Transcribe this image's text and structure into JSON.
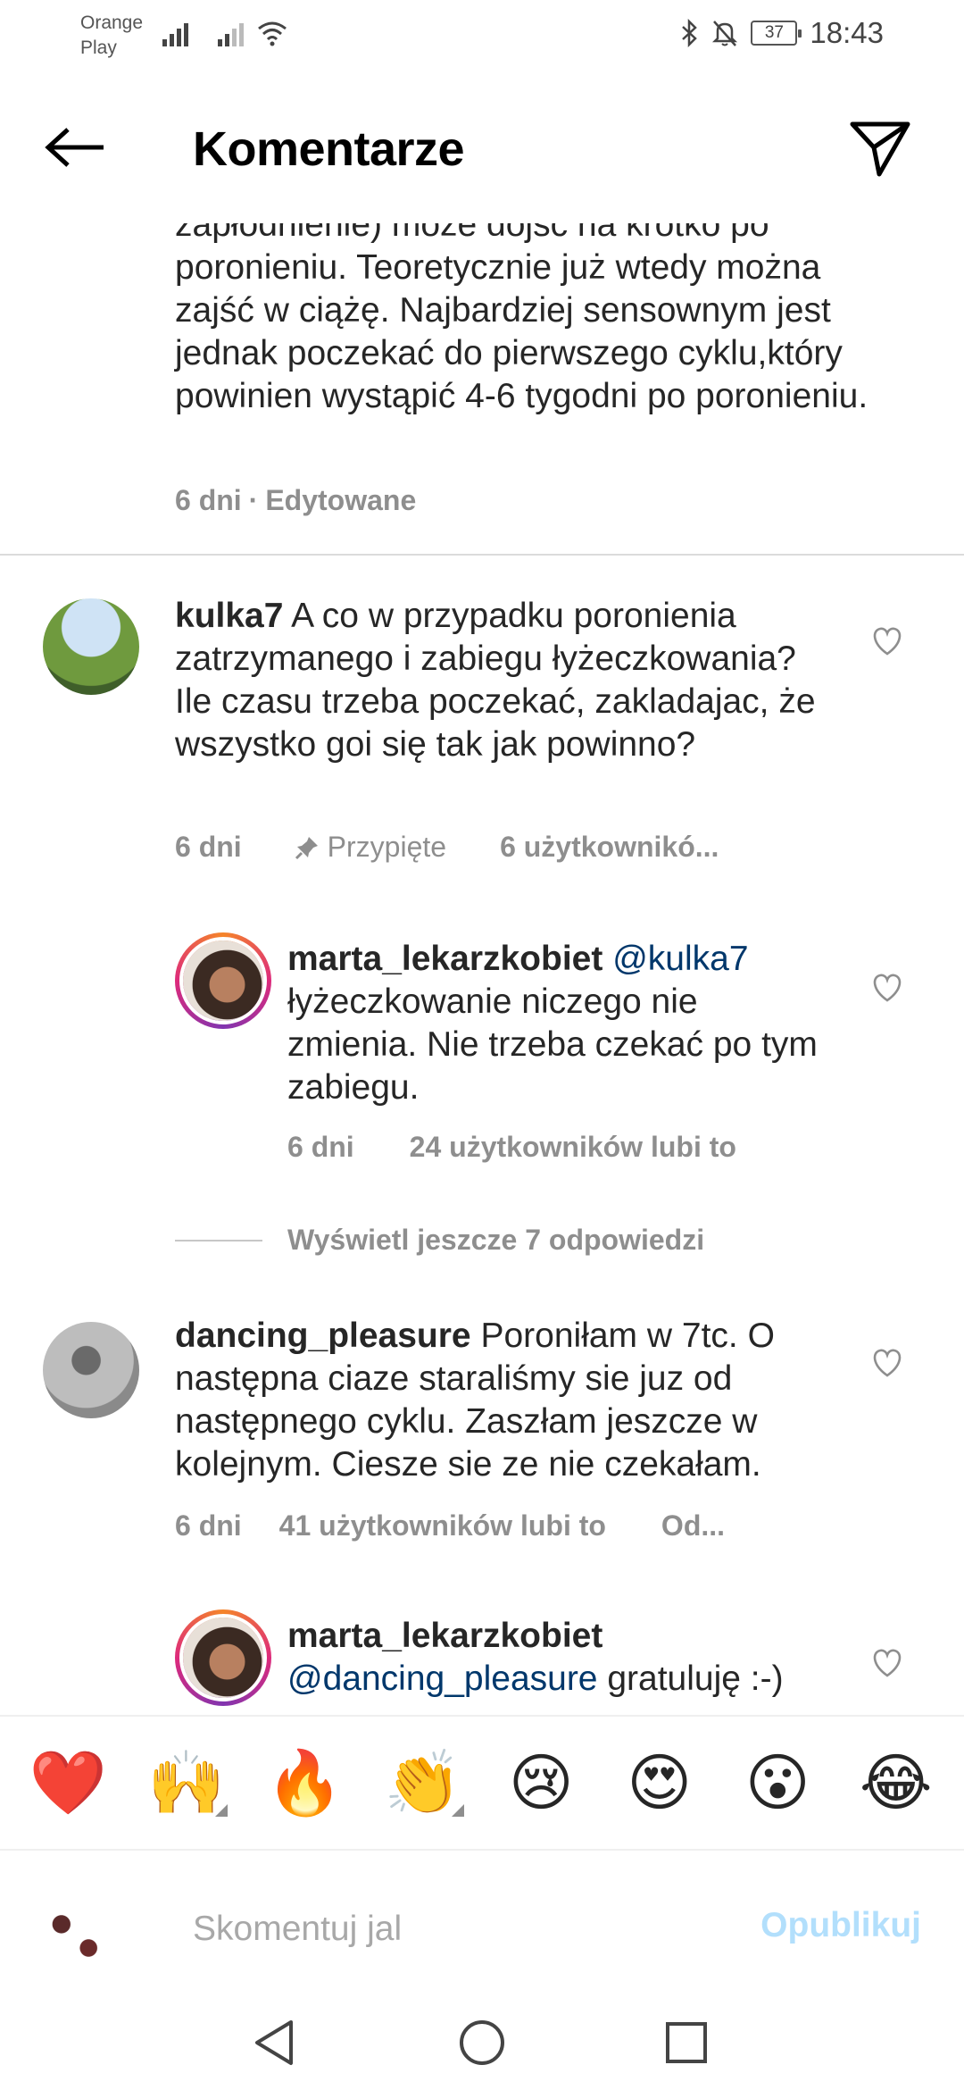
{
  "status_bar": {
    "carrier_line1": "Orange",
    "carrier_line2": "Play",
    "battery": "37",
    "time": "18:43"
  },
  "header": {
    "title": "Komentarze",
    "back_icon": "arrow-left-icon",
    "send_icon": "paper-plane-icon"
  },
  "top_comment": {
    "text": "zapłodnienie) może dojść na krótko po poronieniu. Teoretycznie już wtedy można zajść w ciążę. Najbardziej sensownym jest jednak poczekać do pierwszego cyklu,który powinien wystąpić 4-6 tygodni po poronieniu.",
    "time": "6 dni",
    "edited": "Edytowane"
  },
  "comments": [
    {
      "username": "kulka7",
      "text": "A co w przypadku poronienia zatrzymanego i zabiegu łyżeczkowania? Ile czasu trzeba poczekać, zakladajac, że wszystko goi się tak jak powinno?",
      "time": "6 dni",
      "pinned": "Przypięte",
      "likes": "6 użytkownikó..."
    },
    {
      "username": "dancing_pleasure",
      "text": "Poroniłam w 7tc. O następna ciaze staraliśmy sie juz od następnego cyklu. Zaszłam jeszcze w kolejnym. Ciesze sie ze nie czekałam.",
      "time": "6 dni",
      "likes": "41 użytkowników lubi to",
      "reply": "Od..."
    }
  ],
  "replies": [
    {
      "username": "marta_lekarzkobiet",
      "mention": "@kulka7",
      "text": "łyżeczkowanie niczego nie zmienia. Nie trzeba czekać po tym zabiegu.",
      "time": "6 dni",
      "likes": "24 użytkowników lubi to"
    },
    {
      "username": "marta_lekarzkobiet",
      "mention": "@dancing_pleasure",
      "text": "gratuluję :-)"
    }
  ],
  "more_replies": "Wyświetl jeszcze 7 odpowiedzi",
  "emoji_bar": [
    "❤️",
    "🙌",
    "🔥",
    "👏",
    "😢",
    "😍",
    "😮",
    "😂"
  ],
  "composer": {
    "placeholder": "Skomentuj jal",
    "publish": "Opublikuj"
  }
}
